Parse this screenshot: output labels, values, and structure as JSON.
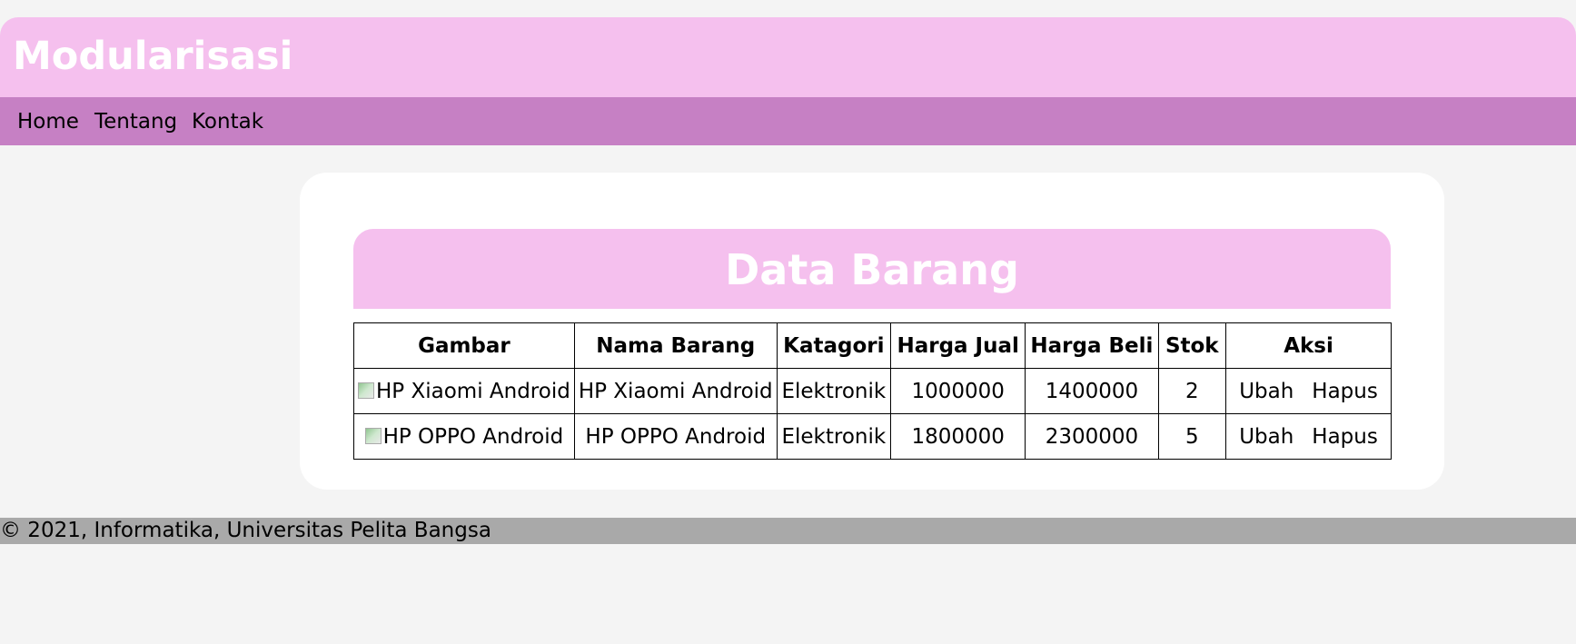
{
  "header": {
    "title": "Modularisasi"
  },
  "nav": {
    "items": [
      "Home",
      "Tentang",
      "Kontak"
    ]
  },
  "content": {
    "heading": "Data Barang",
    "columns": [
      "Gambar",
      "Nama Barang",
      "Katagori",
      "Harga Jual",
      "Harga Beli",
      "Stok",
      "Aksi"
    ],
    "rows": [
      {
        "gambar_alt": "HP Xiaomi Android",
        "nama": "HP Xiaomi Android",
        "katagori": "Elektronik",
        "harga_jual": "1000000",
        "harga_beli": "1400000",
        "stok": "2",
        "ubah": "Ubah",
        "hapus": "Hapus"
      },
      {
        "gambar_alt": "HP OPPO Android",
        "nama": "HP OPPO Android",
        "katagori": "Elektronik",
        "harga_jual": "1800000",
        "harga_beli": "2300000",
        "stok": "5",
        "ubah": "Ubah",
        "hapus": "Hapus"
      }
    ]
  },
  "footer": {
    "text": "© 2021, Informatika, Universitas Pelita Bangsa"
  },
  "colors": {
    "header_bg": "#f5c0ee",
    "nav_bg": "#c680c4",
    "footer_bg": "#a9a9a9",
    "page_bg": "#f4f4f4"
  }
}
